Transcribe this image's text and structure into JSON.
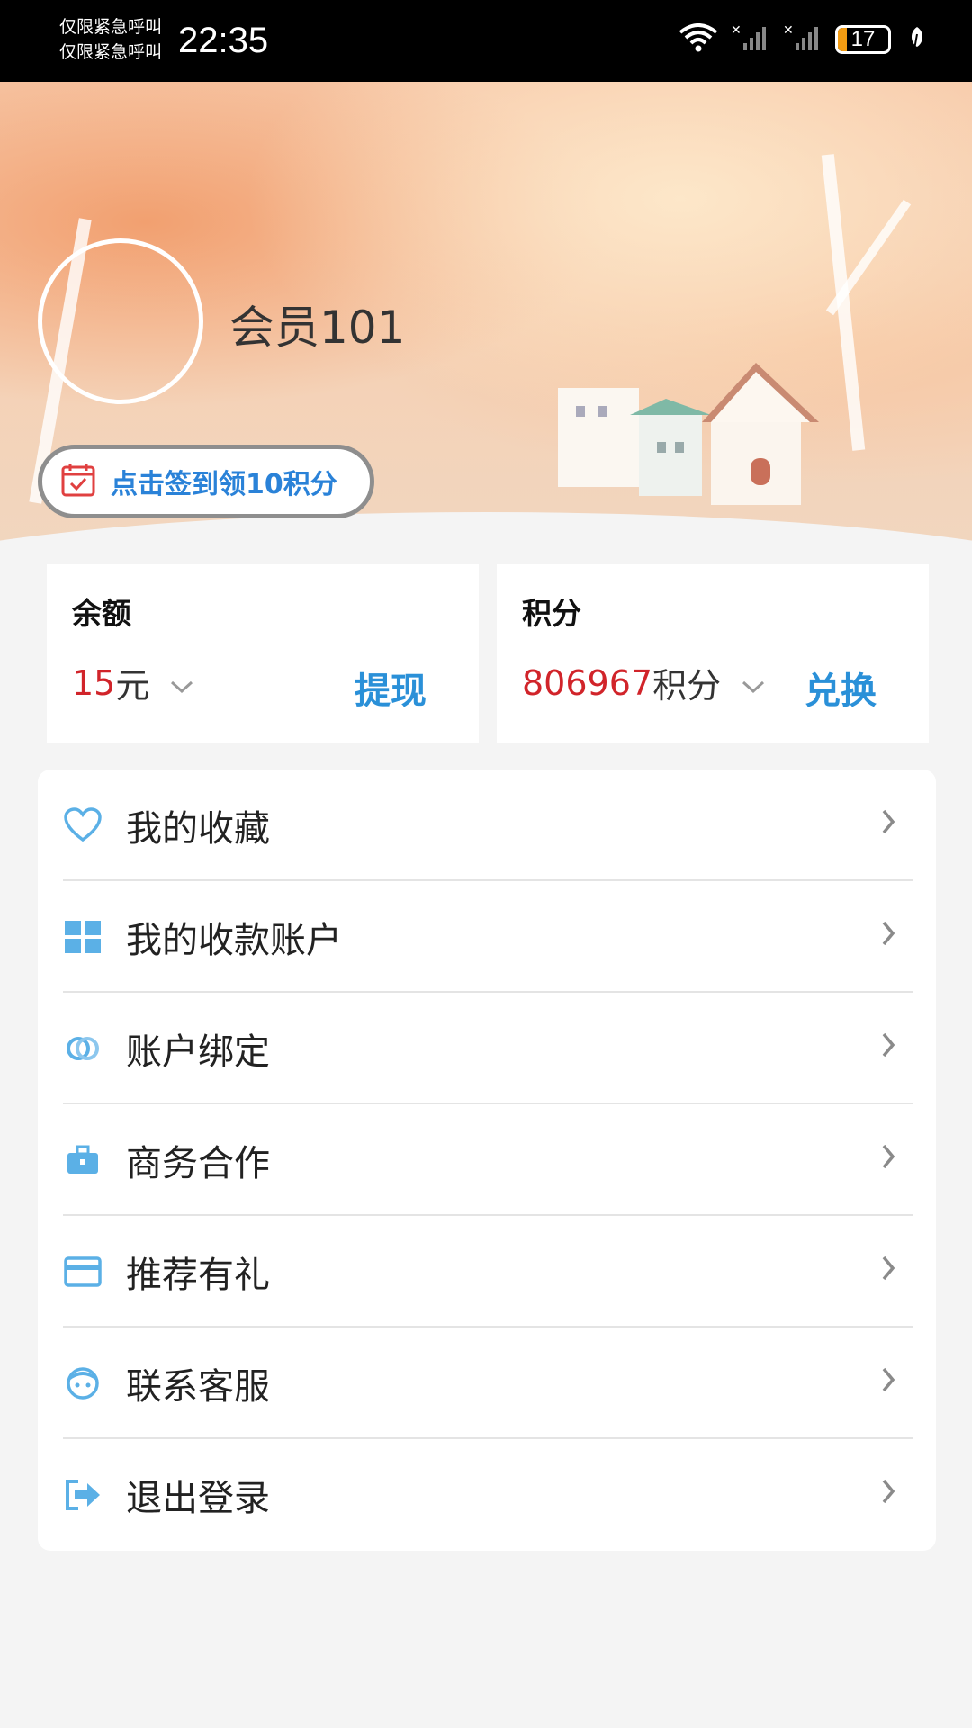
{
  "status_bar": {
    "carrier_line_1": "仅限紧急呼叫",
    "carrier_line_2": "仅限紧急呼叫",
    "time": "22:35",
    "battery_level": "17",
    "battery_fraction": 0.17
  },
  "profile": {
    "username": "会员101",
    "checkin_label": "点击签到领10积分"
  },
  "balance_card": {
    "title": "余额",
    "value": "15",
    "unit": "元",
    "action": "提现"
  },
  "points_card": {
    "title": "积分",
    "value": "806967",
    "unit": "积分",
    "action": "兑换"
  },
  "menu": {
    "items": [
      {
        "label": "我的收藏",
        "icon": "heart-icon"
      },
      {
        "label": "我的收款账户",
        "icon": "grid-icon"
      },
      {
        "label": "账户绑定",
        "icon": "link-icon"
      },
      {
        "label": "商务合作",
        "icon": "briefcase-icon"
      },
      {
        "label": "推荐有礼",
        "icon": "card-icon"
      },
      {
        "label": "联系客服",
        "icon": "face-icon"
      },
      {
        "label": "退出登录",
        "icon": "logout-icon"
      }
    ]
  },
  "colors": {
    "accent_blue": "#2a90d8",
    "value_red": "#d1242a",
    "icon_blue": "#5bb0e6"
  }
}
